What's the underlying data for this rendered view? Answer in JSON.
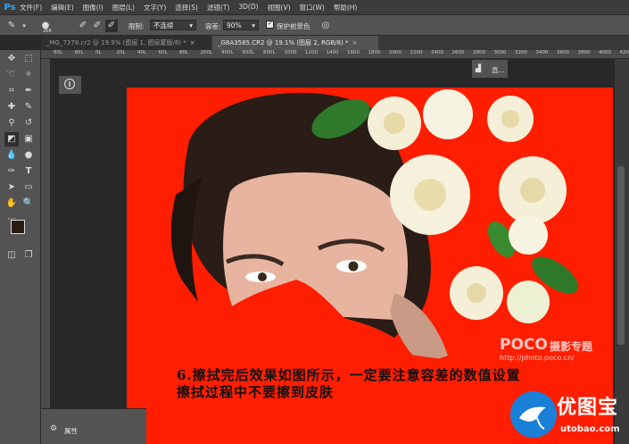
{
  "app": {
    "logo": "Ps"
  },
  "menu": [
    "文件(F)",
    "编辑(E)",
    "图像(I)",
    "图层(L)",
    "文字(Y)",
    "选择(S)",
    "滤镜(T)",
    "3D(D)",
    "视图(V)",
    "窗口(W)",
    "帮助(H)"
  ],
  "options": {
    "brush_size": "268",
    "limits_label": "限制:",
    "limits_value": "不连续",
    "tolerance_label": "容差:",
    "tolerance_value": "90%",
    "protect_label": "保护前景色",
    "protect_checked": true
  },
  "tabs": [
    {
      "label": "_MG_7378.cr2 @ 19.9% (图层 1, 图层蒙版/8) *",
      "active": false
    },
    {
      "label": "_G8A3585.CR2 @ 19.1% (图层 2, RGB/8) *",
      "active": true
    }
  ],
  "ruler_ticks": [
    "60L",
    "80L",
    "0L",
    "20L",
    "40L",
    "60L",
    "80L",
    "200L",
    "400L",
    "600L",
    "800L",
    "1000",
    "1200",
    "1400",
    "1600",
    "1800",
    "2000",
    "2200",
    "2400",
    "2600",
    "2800",
    "3000",
    "3200",
    "3400",
    "3600",
    "3800",
    "4000",
    "4200"
  ],
  "panels": {
    "histogram_label": "直...",
    "properties_label": "属性"
  },
  "canvas": {
    "background_color": "#ff1e00",
    "caption_line1": "6.擦拭完后效果如图所示，一定要注意容差的数值设置",
    "caption_line2": "擦拭过程中不要擦到皮肤",
    "watermark_logo": "POCO",
    "watermark_cn": "摄影专题",
    "watermark_url": "http://photo.poco.cn/"
  },
  "brand": {
    "name": "优图宝",
    "url": "utobao.com"
  }
}
